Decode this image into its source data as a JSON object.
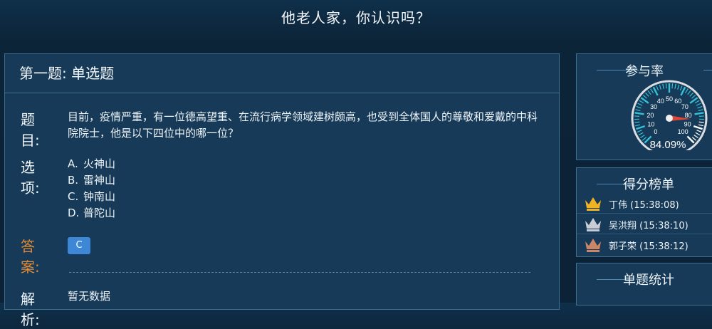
{
  "header": {
    "title": "他老人家，你认识吗？"
  },
  "question": {
    "heading": "第一题: 单选题",
    "prompt_label": "题目:",
    "prompt_text": "目前，疫情严重，有一位德高望重、在流行病学领域建树颇高，也受到全体国人的尊敬和爱戴的中科院院士，他是以下四位中的哪一位？",
    "options_label": "选项:",
    "options": [
      {
        "letter": "A.",
        "text": "火神山"
      },
      {
        "letter": "B.",
        "text": "雷神山"
      },
      {
        "letter": "C.",
        "text": "钟南山"
      },
      {
        "letter": "D.",
        "text": "普陀山"
      }
    ],
    "answer_label": "答案:",
    "answer_value": "C",
    "explain_label": "解析:",
    "explain_text": "暂无数据"
  },
  "participation": {
    "title": "参与率",
    "value_text": "84.09%",
    "value": 84.09,
    "ticks": [
      "0",
      "10",
      "20",
      "30",
      "40",
      "50",
      "60",
      "70",
      "80",
      "90",
      "100"
    ]
  },
  "leaderboard": {
    "title": "得分榜单",
    "entries": [
      {
        "name": "丁伟 (15:38:08)",
        "crown": "gold"
      },
      {
        "name": "吴洪翔 (15:38:10)",
        "crown": "silver"
      },
      {
        "name": "郭子荣 (15:38:12)",
        "crown": "bronze"
      }
    ]
  },
  "stats": {
    "title": "单题统计"
  },
  "colors": {
    "gold": "#f0b323",
    "silver": "#c9ced6",
    "bronze": "#c9876a",
    "gauge_needle": "#e0453a",
    "accent": "#3e86d6"
  }
}
